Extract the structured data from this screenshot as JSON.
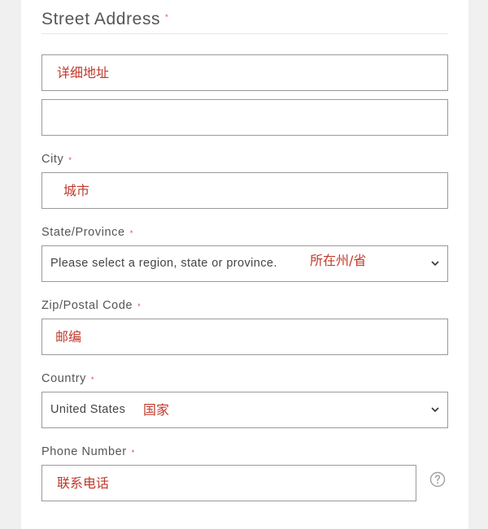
{
  "street": {
    "label": "Street Address",
    "required_mark": "*",
    "line1_hint": "详细地址",
    "line2_value": ""
  },
  "city": {
    "label": "City",
    "required_mark": "*",
    "hint": "城市"
  },
  "state": {
    "label": "State/Province",
    "required_mark": "*",
    "selected": "Please select a region, state or province.",
    "hint": "所在州/省"
  },
  "zip": {
    "label": "Zip/Postal Code",
    "required_mark": "*",
    "hint": "邮编"
  },
  "country": {
    "label": "Country",
    "required_mark": "*",
    "selected": "United States",
    "hint": "国家"
  },
  "phone": {
    "label": "Phone Number",
    "required_mark": "*",
    "hint": "联系电话"
  },
  "icons": {
    "dropdown": "chevron-down-icon",
    "help": "question-circle-icon"
  },
  "colors": {
    "hint_text": "#c0392b",
    "required_mark": "#e04040",
    "border": "#9a9a9a"
  }
}
